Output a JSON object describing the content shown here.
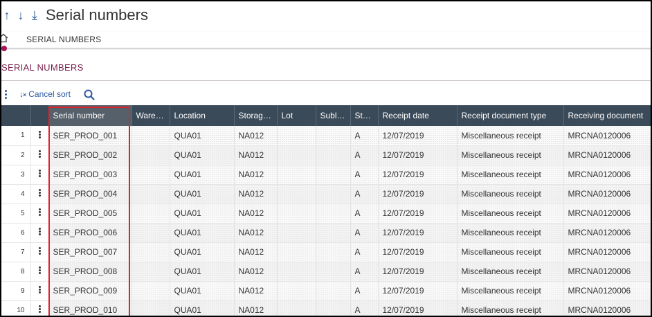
{
  "header": {
    "nav_up": "↑",
    "nav_down": "↓",
    "nav_last": "⤓",
    "title": "Serial numbers"
  },
  "breadcrumb": {
    "label": "SERIAL NUMBERS"
  },
  "section": {
    "title": "SERIAL NUMBERS"
  },
  "toolbar": {
    "cancel_sort_label": "Cancel sort",
    "sort_icon": "↓",
    "sort_icon_suffix": "×"
  },
  "grid": {
    "columns": [
      {
        "label": "Serial number"
      },
      {
        "label": "Ware…",
        "sort": "↑"
      },
      {
        "label": "Location"
      },
      {
        "label": "Storag…"
      },
      {
        "label": "Lot"
      },
      {
        "label": "Subl…"
      },
      {
        "label": "St…"
      },
      {
        "label": "Receipt date"
      },
      {
        "label": "Receipt document type"
      },
      {
        "label": "Receiving document"
      }
    ],
    "rows": [
      {
        "no": "1",
        "serial": "SER_PROD_001",
        "warehouse": "",
        "location": "QUA01",
        "storage": "NA012",
        "lot": "",
        "sublot": "",
        "status": "A",
        "receipt_date": "12/07/2019",
        "doc_type": "Miscellaneous receipt",
        "receiving_doc": "MRCNA0120006"
      },
      {
        "no": "2",
        "serial": "SER_PROD_002",
        "warehouse": "",
        "location": "QUA01",
        "storage": "NA012",
        "lot": "",
        "sublot": "",
        "status": "A",
        "receipt_date": "12/07/2019",
        "doc_type": "Miscellaneous receipt",
        "receiving_doc": "MRCNA0120006"
      },
      {
        "no": "3",
        "serial": "SER_PROD_003",
        "warehouse": "",
        "location": "QUA01",
        "storage": "NA012",
        "lot": "",
        "sublot": "",
        "status": "A",
        "receipt_date": "12/07/2019",
        "doc_type": "Miscellaneous receipt",
        "receiving_doc": "MRCNA0120006"
      },
      {
        "no": "4",
        "serial": "SER_PROD_004",
        "warehouse": "",
        "location": "QUA01",
        "storage": "NA012",
        "lot": "",
        "sublot": "",
        "status": "A",
        "receipt_date": "12/07/2019",
        "doc_type": "Miscellaneous receipt",
        "receiving_doc": "MRCNA0120006"
      },
      {
        "no": "5",
        "serial": "SER_PROD_005",
        "warehouse": "",
        "location": "QUA01",
        "storage": "NA012",
        "lot": "",
        "sublot": "",
        "status": "A",
        "receipt_date": "12/07/2019",
        "doc_type": "Miscellaneous receipt",
        "receiving_doc": "MRCNA0120006"
      },
      {
        "no": "6",
        "serial": "SER_PROD_006",
        "warehouse": "",
        "location": "QUA01",
        "storage": "NA012",
        "lot": "",
        "sublot": "",
        "status": "A",
        "receipt_date": "12/07/2019",
        "doc_type": "Miscellaneous receipt",
        "receiving_doc": "MRCNA0120006"
      },
      {
        "no": "7",
        "serial": "SER_PROD_007",
        "warehouse": "",
        "location": "QUA01",
        "storage": "NA012",
        "lot": "",
        "sublot": "",
        "status": "A",
        "receipt_date": "12/07/2019",
        "doc_type": "Miscellaneous receipt",
        "receiving_doc": "MRCNA0120006"
      },
      {
        "no": "8",
        "serial": "SER_PROD_008",
        "warehouse": "",
        "location": "QUA01",
        "storage": "NA012",
        "lot": "",
        "sublot": "",
        "status": "A",
        "receipt_date": "12/07/2019",
        "doc_type": "Miscellaneous receipt",
        "receiving_doc": "MRCNA0120006"
      },
      {
        "no": "9",
        "serial": "SER_PROD_009",
        "warehouse": "",
        "location": "QUA01",
        "storage": "NA012",
        "lot": "",
        "sublot": "",
        "status": "A",
        "receipt_date": "12/07/2019",
        "doc_type": "Miscellaneous receipt",
        "receiving_doc": "MRCNA0120006"
      },
      {
        "no": "10",
        "serial": "SER_PROD_010",
        "warehouse": "",
        "location": "QUA01",
        "storage": "NA012",
        "lot": "",
        "sublot": "",
        "status": "A",
        "receipt_date": "12/07/2019",
        "doc_type": "Miscellaneous receipt",
        "receiving_doc": "MRCNA0120006"
      }
    ]
  },
  "colors": {
    "accent": "#2c5aa0",
    "section_title": "#7a1f4c",
    "header_bg": "#3b4a59",
    "highlight": "#e0232a"
  }
}
